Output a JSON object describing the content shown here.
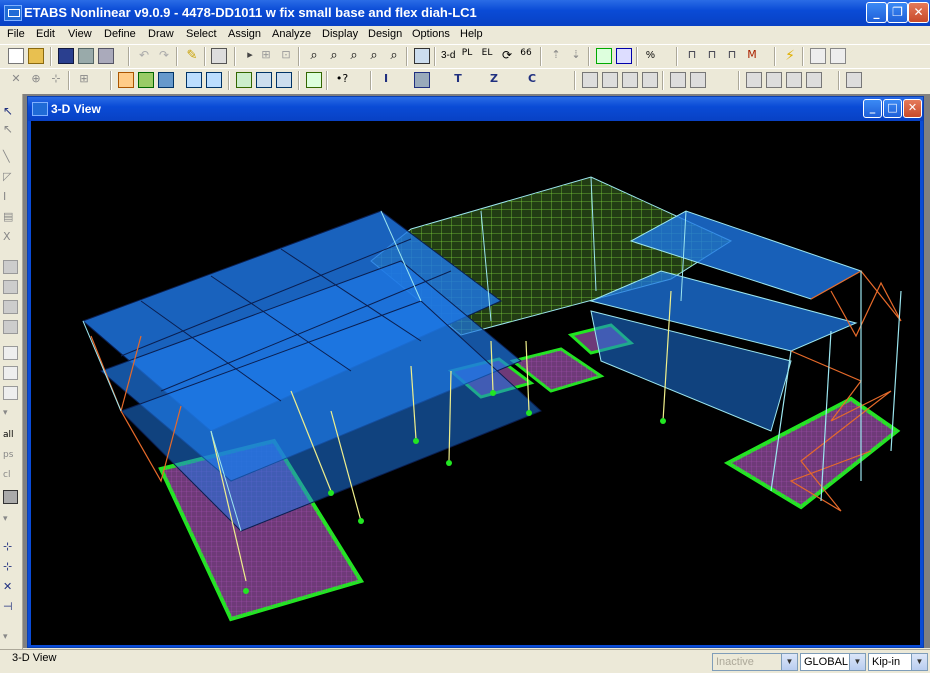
{
  "window": {
    "title": "ETABS Nonlinear v9.0.9 - 4478-DD1011 w fix small base and flex diah-LC1"
  },
  "menu": [
    "File",
    "Edit",
    "View",
    "Define",
    "Draw",
    "Select",
    "Assign",
    "Analyze",
    "Display",
    "Design",
    "Options",
    "Help"
  ],
  "toolbar": {
    "view_3d_label": "3-d",
    "zoom_percent_label": "%",
    "plan_label": "Plan"
  },
  "child_window": {
    "title": "3-D View"
  },
  "status": {
    "left_text": "3-D View",
    "inactive_value": "Inactive",
    "coord_system_value": "GLOBAL",
    "units_value": "Kip-in"
  },
  "colors": {
    "viewport_bg": "#000000",
    "slab_blue": "#1E78E6",
    "mesh_green": "#7CD23C",
    "footing_purple": "#8C4696",
    "footing_edge": "#22E622",
    "brace_orange": "#E66A2A",
    "column_yellow": "#F0F08C",
    "frame_cyan": "#9CE6F0"
  }
}
